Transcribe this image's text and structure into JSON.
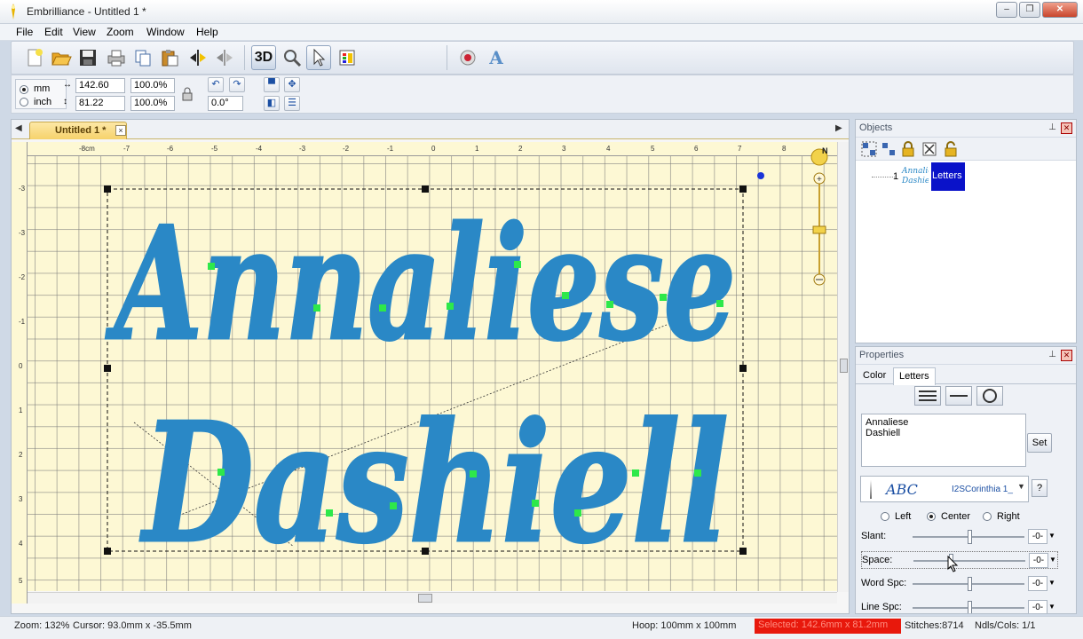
{
  "window": {
    "title": "Embrilliance - Untitled 1 *",
    "min": "–",
    "max": "❐",
    "close": "✕"
  },
  "menu": [
    "File",
    "Edit",
    "View",
    "Zoom",
    "Window",
    "Help"
  ],
  "toolbar": {
    "icons": [
      "new-icon",
      "open-folder-icon",
      "save-icon",
      "print-icon",
      "copy-icon",
      "paste-icon",
      "mirror-horizontal-icon",
      "mirror-vertical-icon",
      "3d-view-icon",
      "magnifier-icon",
      "pointer-icon",
      "color-sort-icon",
      "stitch-settings-icon",
      "lettering-icon"
    ],
    "view3d_label": "3D",
    "letter_label": "A"
  },
  "measure": {
    "unit_mm": "mm",
    "unit_inch": "inch",
    "width": "142.60",
    "height": "81.22",
    "width_pct": "100.0%",
    "height_pct": "100.0%",
    "rotation": "0.0°"
  },
  "document": {
    "tab_label": "Untitled 1 *",
    "tab_close": "×",
    "scroll_left": "◀",
    "scroll_right": "▶"
  },
  "ruler": {
    "h": [
      "-8cm",
      "-7",
      "-6",
      "-5",
      "-4",
      "-3",
      "-2",
      "-1",
      "0",
      "1",
      "2",
      "3",
      "4",
      "5",
      "6",
      "7",
      "8"
    ],
    "v": [
      "-3",
      "-3",
      "-2",
      "-1",
      "0",
      "1",
      "2",
      "3",
      "4",
      "5"
    ]
  },
  "zoom_slider": {
    "north": "N"
  },
  "design": {
    "line1": "Annaliese",
    "line2": "Dashiell",
    "color": "#2a88c6"
  },
  "objects_panel": {
    "title": "Objects",
    "pin": "⊥",
    "close": "✕",
    "item_number": "1",
    "item_label": "Letters"
  },
  "properties_panel": {
    "title": "Properties",
    "pin": "⊥",
    "close": "✕",
    "tab_color": "Color",
    "tab_letters": "Letters",
    "text_line1": "Annaliese",
    "text_line2": "Dashiell",
    "set_label": "Set",
    "font_sample": "ABC",
    "font_name": "I2SCorinthia 1_",
    "font_dropdown": "▼",
    "help_label": "?",
    "justify_left": "Left",
    "justify_center": "Center",
    "justify_right": "Right",
    "sliders": [
      {
        "label": "Slant:",
        "value": "-0-"
      },
      {
        "label": "Space:",
        "value": "-0-"
      },
      {
        "label": "Word Spc:",
        "value": "-0-"
      },
      {
        "label": "Line Spc:",
        "value": "-0-"
      }
    ]
  },
  "status": {
    "zoom": "Zoom: 132%",
    "cursor": "Cursor: 93.0mm x -35.5mm",
    "hoop": "Hoop: 100mm x 100mm",
    "selected": "Selected: 142.6mm x 81.2mm",
    "stitches": "Stitches:8714",
    "ndls": "Ndls/Cols: 1/1"
  }
}
